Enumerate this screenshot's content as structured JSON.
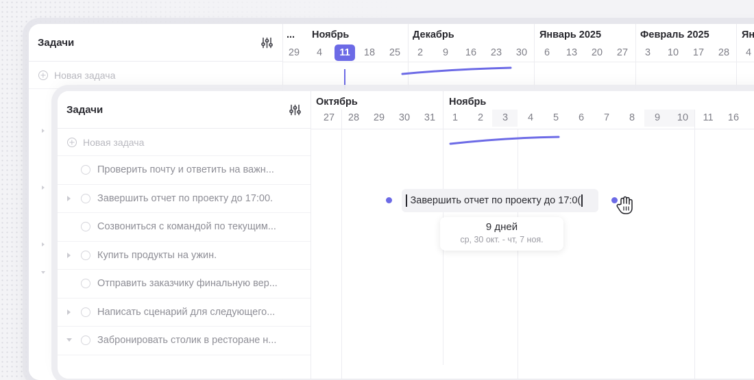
{
  "back_panel": {
    "sidebar": {
      "title": "Задачи",
      "new_task_placeholder": "Новая задача"
    },
    "timeline": {
      "months": [
        "...",
        "Ноябрь",
        "Декабрь",
        "Январь 2025",
        "Февраль 2025",
        "Ян"
      ],
      "days": [
        "29",
        "4",
        "11",
        "18",
        "25",
        "2",
        "9",
        "16",
        "23",
        "30",
        "6",
        "13",
        "20",
        "27",
        "3",
        "10",
        "17",
        "28",
        "4"
      ],
      "today": "11"
    }
  },
  "front_panel": {
    "sidebar": {
      "title": "Задачи",
      "new_task_placeholder": "Новая задача",
      "tasks": [
        {
          "label": "Проверить почту и ответить на важн...",
          "has_children": false
        },
        {
          "label": "Завершить отчет по проекту до 17:00.",
          "has_children": true
        },
        {
          "label": "Созвониться с командой по текущим...",
          "has_children": false
        },
        {
          "label": "Купить продукты на ужин.",
          "has_children": true
        },
        {
          "label": "Отправить заказчику финальную вер...",
          "has_children": false
        },
        {
          "label": "Написать сценарий для следующего...",
          "has_children": true
        },
        {
          "label": "Забронировать столик в ресторане н...",
          "has_children": true
        }
      ]
    },
    "timeline": {
      "months": [
        "Октябрь",
        "Ноябрь"
      ],
      "days": [
        "27",
        "28",
        "29",
        "30",
        "31",
        "1",
        "2",
        "3",
        "4",
        "5",
        "6",
        "7",
        "8",
        "9",
        "10",
        "11",
        "16"
      ]
    },
    "task_bar": {
      "text": "Завершить отчет по проекту до 17:0("
    },
    "tooltip": {
      "duration": "9 дней",
      "range": "ср, 30 окт. - чт, 7 ноя."
    }
  },
  "colors": {
    "accent": "#6c6ae6",
    "background": "#f3f3f6",
    "panel": "#ffffff"
  },
  "icons": [
    "filter-sliders-icon",
    "plus-circle-icon",
    "expand-caret-icon",
    "task-checkbox-icon",
    "grab-hand-cursor-icon"
  ]
}
